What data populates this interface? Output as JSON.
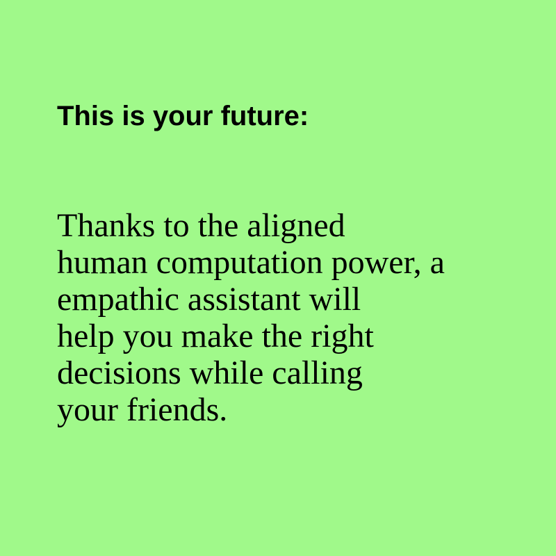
{
  "heading": "This is your future:",
  "body_lines": [
    "Thanks to the aligned",
    "human computation power, a",
    "empathic assistant will",
    "help you make the right",
    "decisions while calling",
    "your friends."
  ],
  "colors": {
    "background": "#a0f98a",
    "text": "#000000"
  }
}
